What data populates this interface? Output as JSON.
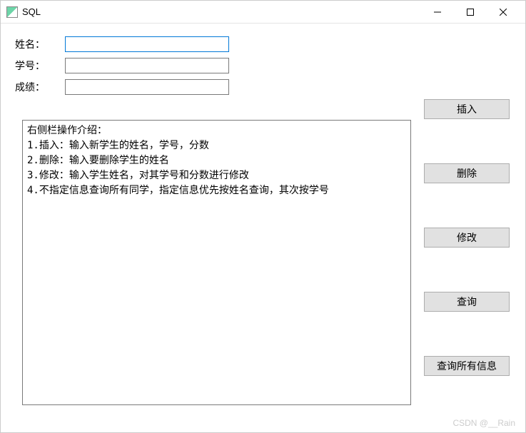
{
  "window": {
    "title": "SQL"
  },
  "form": {
    "name": {
      "label": "姓名：",
      "value": ""
    },
    "studentId": {
      "label": "学号：",
      "value": ""
    },
    "score": {
      "label": "成绩：",
      "value": ""
    }
  },
  "output": {
    "text": "右侧栏操作介绍：\n1.插入：输入新学生的姓名，学号，分数\n2.删除：输入要删除学生的姓名\n3.修改：输入学生姓名，对其学号和分数进行修改\n4.不指定信息查询所有同学，指定信息优先按姓名查询，其次按学号"
  },
  "buttons": {
    "insert": "插入",
    "delete": "删除",
    "update": "修改",
    "query": "查询",
    "queryAll": "查询所有信息"
  },
  "watermark": "CSDN @__Rain"
}
